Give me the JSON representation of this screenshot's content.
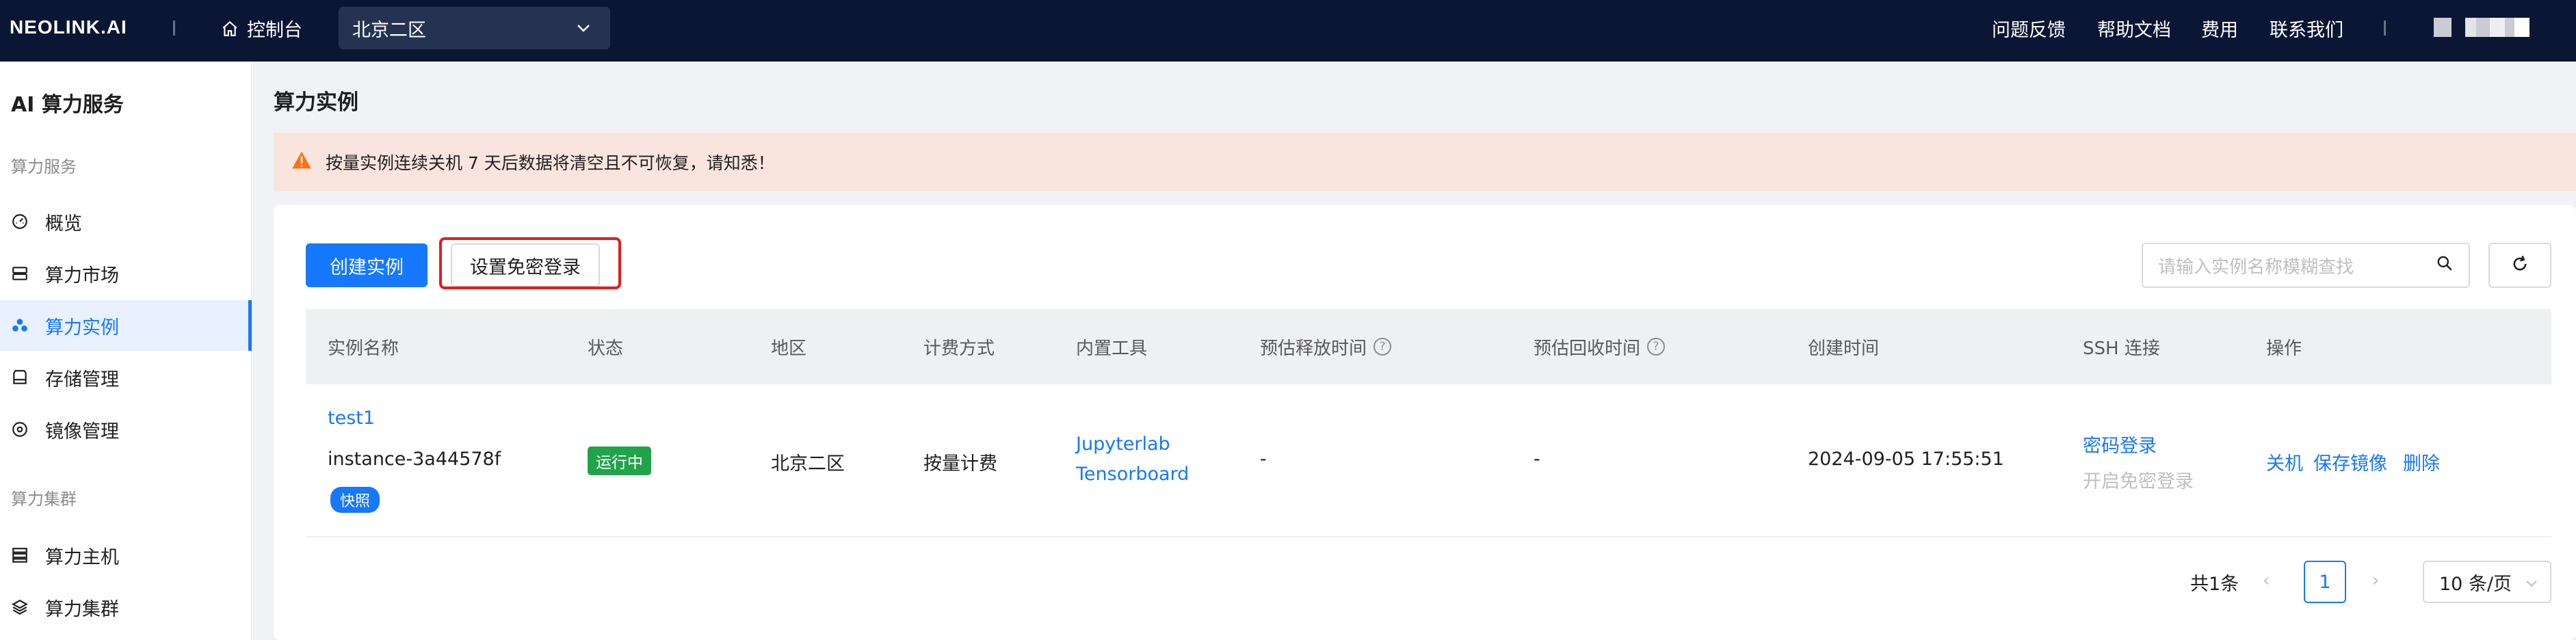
{
  "topbar": {
    "logo": "NEOLINK.AI",
    "console_label": "控制台",
    "region_value": "北京二区",
    "nav": [
      "问题反馈",
      "帮助文档",
      "费用",
      "联系我们"
    ]
  },
  "sidebar": {
    "title": "AI 算力服务",
    "group1": "算力服务",
    "items1": [
      {
        "label": "概览",
        "icon": "dashboard-icon"
      },
      {
        "label": "算力市场",
        "icon": "server-icon"
      },
      {
        "label": "算力实例",
        "icon": "cluster-icon"
      },
      {
        "label": "存储管理",
        "icon": "storage-icon"
      },
      {
        "label": "镜像管理",
        "icon": "image-icon"
      }
    ],
    "group2": "算力集群",
    "items2": [
      {
        "label": "算力主机",
        "icon": "host-icon"
      },
      {
        "label": "算力集群",
        "icon": "layers-icon"
      }
    ]
  },
  "main": {
    "title": "算力实例",
    "alert": "按量实例连续关机 7 天后数据将清空且不可恢复，请知悉！",
    "create_button": "创建实例",
    "passwordless_button": "设置免密登录",
    "search_placeholder": "请输入实例名称模糊查找"
  },
  "table": {
    "headers": [
      "实例名称",
      "状态",
      "地区",
      "计费方式",
      "内置工具",
      "预估释放时间",
      "预估回收时间",
      "创建时间",
      "SSH 连接",
      "操作"
    ],
    "row": {
      "name": "test1",
      "id": "instance-3a44578f",
      "snapshot_tag": "快照",
      "status": "运行中",
      "region": "北京二区",
      "billing": "按量计费",
      "tool1": "Jupyterlab",
      "tool2": "Tensorboard",
      "release_time": "-",
      "recycle_time": "-",
      "created": "2024-09-05 17:55:51",
      "ssh_password": "密码登录",
      "ssh_passwordless": "开启免密登录",
      "action_shutdown": "关机",
      "action_save_image": "保存镜像",
      "action_delete": "删除"
    }
  },
  "pagination": {
    "total": "共1条",
    "current_page": "1",
    "page_size": "10 条/页"
  },
  "colors": {
    "topbar_bg": "#0b1634",
    "primary": "#1677ff",
    "running": "#21a34a",
    "alert_bg": "#f9e5dd",
    "highlight": "#e11d1d"
  }
}
